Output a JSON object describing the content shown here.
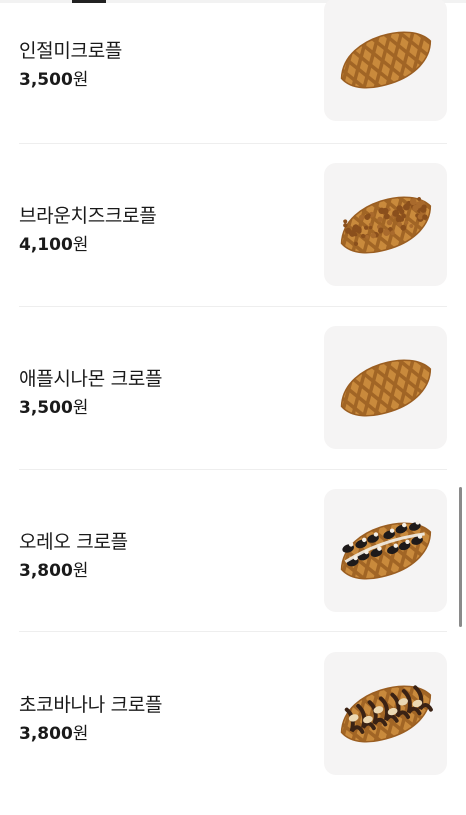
{
  "menu": {
    "items": [
      {
        "name": "인절미크로플",
        "price": "3,500",
        "unit": "원",
        "image": "injeolmi-croffle-photo",
        "topping": "plain"
      },
      {
        "name": "브라운치즈크로플",
        "price": "4,100",
        "unit": "원",
        "image": "brown-cheese-croffle-photo",
        "topping": "cheese"
      },
      {
        "name": "애플시나몬 크로플",
        "price": "3,500",
        "unit": "원",
        "image": "apple-cinnamon-croffle-photo",
        "topping": "plain"
      },
      {
        "name": "오레오 크로플",
        "price": "3,800",
        "unit": "원",
        "image": "oreo-croffle-photo",
        "topping": "oreo"
      },
      {
        "name": "초코바나나 크로플",
        "price": "3,800",
        "unit": "원",
        "image": "choco-banana-croffle-photo",
        "topping": "choco"
      }
    ]
  },
  "colors": {
    "waffle": "#c98a3c",
    "waffle_dark": "#9a5e22",
    "thumb_bg": "#f5f4f4"
  }
}
